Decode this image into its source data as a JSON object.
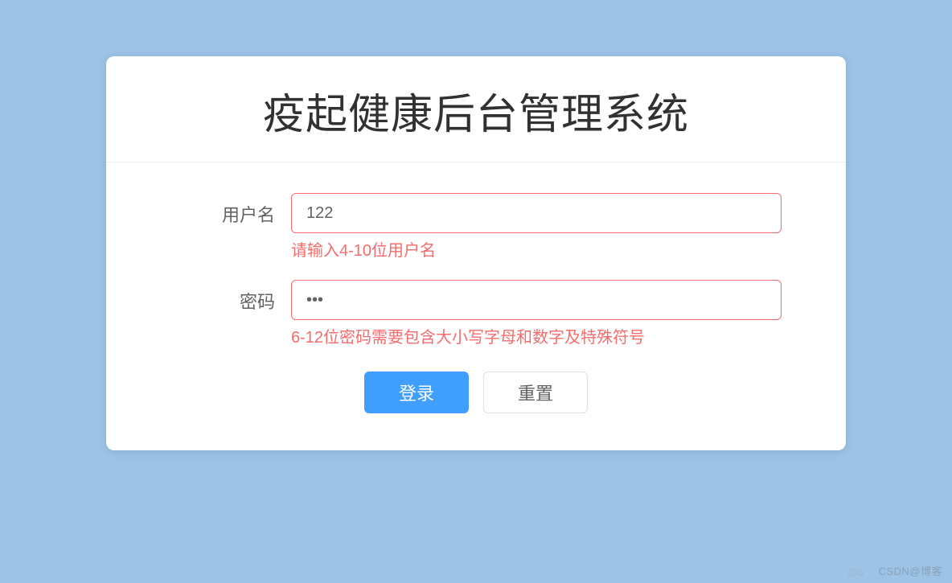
{
  "header": {
    "title": "疫起健康后台管理系统"
  },
  "form": {
    "username": {
      "label": "用户名",
      "value": "122",
      "error": "请输入4-10位用户名"
    },
    "password": {
      "label": "密码",
      "value": "•••",
      "error": "6-12位密码需要包含大小写字母和数字及特殊符号"
    },
    "buttons": {
      "login": "登录",
      "reset": "重置"
    }
  },
  "watermark": {
    "text1": "CSDN@博客",
    "text2": "@5"
  }
}
